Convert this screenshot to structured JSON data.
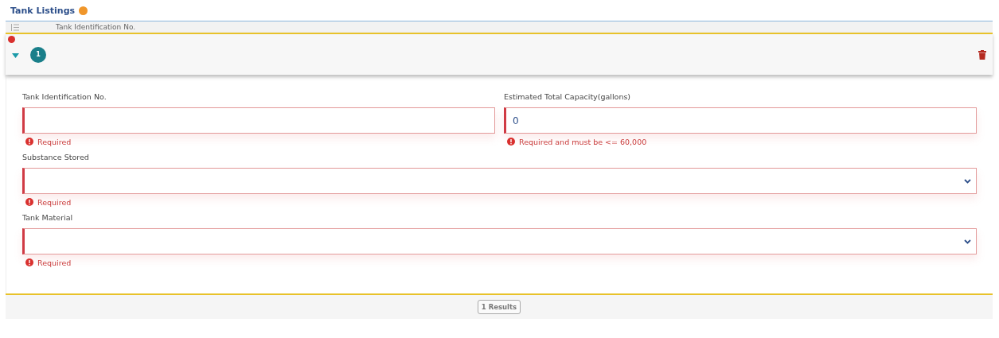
{
  "section": {
    "title": "Tank Listings"
  },
  "column_header": {
    "label": "Tank Identification No."
  },
  "record": {
    "number": "1",
    "expanded": true,
    "has_error": true
  },
  "rows": [
    [
      {
        "kind": "text",
        "label": "Tank Identification No.",
        "invalid": true,
        "error": "Required"
      },
      {
        "kind": "text",
        "label": "Estimated Total Capacity(gallons)",
        "value": "0",
        "invalid": true,
        "error": "Required and must be <= 60,000"
      }
    ],
    [
      {
        "kind": "select",
        "label": "Substance Stored",
        "invalid": true,
        "error": "Required"
      }
    ],
    [
      {
        "kind": "select",
        "label": "Tank Material",
        "invalid": true,
        "error": "Required"
      }
    ]
  ],
  "footer": {
    "results": "1 Results"
  }
}
